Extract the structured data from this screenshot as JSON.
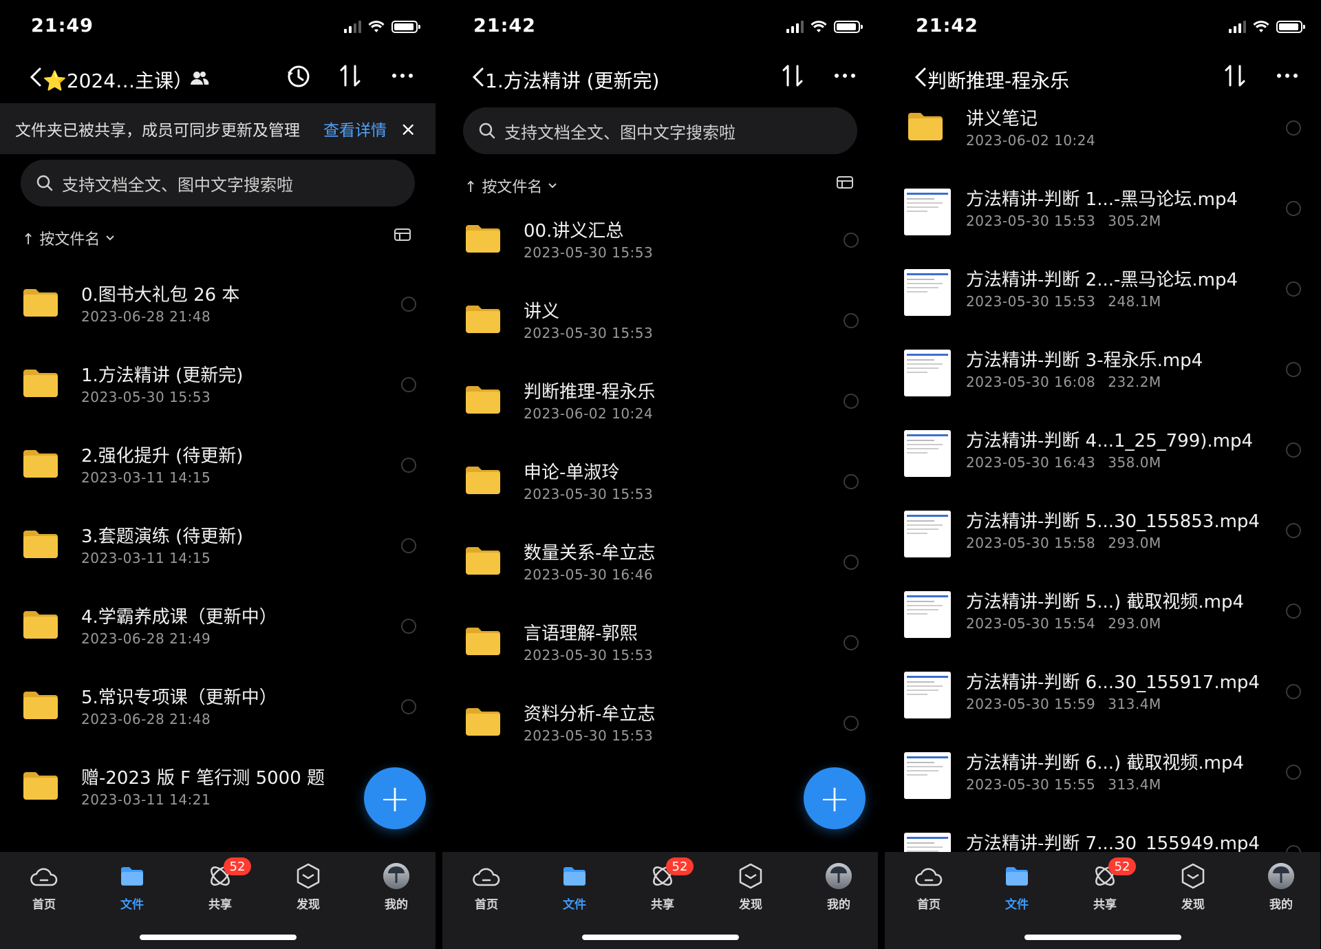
{
  "status_bars": [
    {
      "time": "21:49"
    },
    {
      "time": "21:42"
    },
    {
      "time": "21:42"
    }
  ],
  "panel1": {
    "title": "⭐2024…主课）",
    "banner": {
      "text": "文件夹已被共享，成员可同步更新及管理",
      "link": "查看详情",
      "close": "×"
    },
    "search_placeholder": "支持文档全文、图中文字搜索啦",
    "sort_label": "↑ 按文件名",
    "items": [
      {
        "title": "0.图书大礼包 26 本",
        "meta": "2023-06-28 21:48"
      },
      {
        "title": "1.方法精讲 (更新完)",
        "meta": "2023-05-30 15:53"
      },
      {
        "title": "2.强化提升 (待更新)",
        "meta": "2023-03-11 14:15"
      },
      {
        "title": "3.套题演练 (待更新)",
        "meta": "2023-03-11 14:15"
      },
      {
        "title": "4.学霸养成课（更新中）",
        "meta": "2023-06-28 21:49"
      },
      {
        "title": "5.常识专项课（更新中）",
        "meta": "2023-06-28 21:48"
      },
      {
        "title": "赠-2023 版 F 笔行测 5000 题",
        "meta": "2023-03-11 14:21"
      }
    ],
    "fab": "+"
  },
  "panel2": {
    "title": "1.方法精讲 (更新完)",
    "search_placeholder": "支持文档全文、图中文字搜索啦",
    "sort_label": "↑ 按文件名",
    "items": [
      {
        "title": "00.讲义汇总",
        "meta": "2023-05-30 15:53"
      },
      {
        "title": "讲义",
        "meta": "2023-05-30 15:53"
      },
      {
        "title": "判断推理-程永乐",
        "meta": "2023-06-02 10:24"
      },
      {
        "title": "申论-单淑玲",
        "meta": "2023-05-30 15:53"
      },
      {
        "title": "数量关系-牟立志",
        "meta": "2023-05-30 16:46"
      },
      {
        "title": "言语理解-郭熙",
        "meta": "2023-05-30 15:53"
      },
      {
        "title": "资料分析-牟立志",
        "meta": "2023-05-30 15:53"
      }
    ],
    "fab": "+"
  },
  "panel3": {
    "title": "判断推理-程永乐",
    "folder": {
      "title": "讲义笔记",
      "meta": "2023-06-02 10:24"
    },
    "items": [
      {
        "title": "方法精讲-判断 1...-黑马论坛.mp4",
        "meta": "2023-05-30 15:53",
        "size": "305.2M"
      },
      {
        "title": "方法精讲-判断 2...-黑马论坛.mp4",
        "meta": "2023-05-30 15:53",
        "size": "248.1M"
      },
      {
        "title": "方法精讲-判断 3-程永乐.mp4",
        "meta": "2023-05-30 16:08",
        "size": "232.2M"
      },
      {
        "title": "方法精讲-判断 4...1_25_799).mp4",
        "meta": "2023-05-30 16:43",
        "size": "358.0M"
      },
      {
        "title": "方法精讲-判断 5...30_155853.mp4",
        "meta": "2023-05-30 15:58",
        "size": "293.0M"
      },
      {
        "title": "方法精讲-判断 5...) 截取视频.mp4",
        "meta": "2023-05-30 15:54",
        "size": "293.0M"
      },
      {
        "title": "方法精讲-判断 6...30_155917.mp4",
        "meta": "2023-05-30 15:59",
        "size": "313.4M"
      },
      {
        "title": "方法精讲-判断 6...) 截取视频.mp4",
        "meta": "2023-05-30 15:55",
        "size": "313.4M"
      },
      {
        "title": "方法精讲-判断 7...30_155949.mp4",
        "meta": "",
        "size": ""
      }
    ]
  },
  "tabbar": {
    "tabs": [
      {
        "label": "首页",
        "icon": "cloud-home-icon"
      },
      {
        "label": "文件",
        "icon": "folder-icon",
        "active": true
      },
      {
        "label": "共享",
        "icon": "share-atom-icon",
        "badge": "52"
      },
      {
        "label": "发现",
        "icon": "cube-icon"
      },
      {
        "label": "我的",
        "icon": "avatar-icon"
      }
    ]
  },
  "colors": {
    "accent": "#2a8cf0",
    "folder": "#f5c542",
    "badge": "#ff3b30",
    "link": "#4ea1ff"
  }
}
